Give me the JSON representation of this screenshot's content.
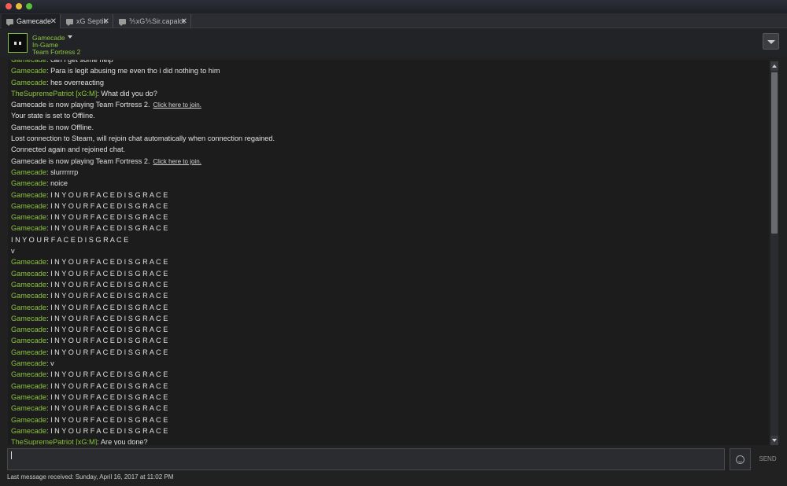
{
  "tabs": [
    {
      "label": "Gamecade"
    },
    {
      "label": "xG Septik"
    },
    {
      "label": "⅗xG⅗Sir.capalot"
    }
  ],
  "header": {
    "friend_name": "Gamecade",
    "status": "In-Game",
    "game": "Team Fortress 2"
  },
  "messages": [
    {
      "sender": "Gamecade",
      "text": "can i get some help"
    },
    {
      "sender": "Gamecade",
      "text": "Para is legit abusing me even tho i did nothing to him"
    },
    {
      "sender": "Gamecade",
      "text": "hes overreacting"
    },
    {
      "sender": "TheSupremePatriot [xG:M]",
      "text": "What did you do?"
    },
    {
      "text": "Gamecade is now playing Team Fortress 2.",
      "link": "Click here to join."
    },
    {
      "text": "Your state is set to Offline."
    },
    {
      "text": "Gamecade is now Offline."
    },
    {
      "text": "Lost connection to Steam, will rejoin chat automatically when connection regained."
    },
    {
      "text": "Connected again and rejoined chat."
    },
    {
      "text": "Gamecade is now playing Team Fortress 2.",
      "link": "Click here to join."
    },
    {
      "sender": "Gamecade",
      "text": "slurrrrrrp"
    },
    {
      "sender": "Gamecade",
      "text": "noice"
    },
    {
      "sender": "Gamecade",
      "text": "I N Y O U R F A C E D I S G R A C E"
    },
    {
      "sender": "Gamecade",
      "text": "I N Y O U R F A C E D I S G R A C E"
    },
    {
      "sender": "Gamecade",
      "text": "I N Y O U R F A C E D I S G R A C E"
    },
    {
      "sender": "Gamecade",
      "text": "I N Y O U R F A C E D I S G R A C E"
    },
    {
      "text": "I N Y O U R F A C E D I S G R A C E"
    },
    {
      "text": "v"
    },
    {
      "sender": "Gamecade",
      "text": "I N Y O U R F A C E D I S G R A C E"
    },
    {
      "sender": "Gamecade",
      "text": "I N Y O U R F A C E D I S G R A C E"
    },
    {
      "sender": "Gamecade",
      "text": "I N Y O U R F A C E D I S G R A C E"
    },
    {
      "sender": "Gamecade",
      "text": "I N Y O U R F A C E D I S G R A C E"
    },
    {
      "sender": "Gamecade",
      "text": "I N Y O U R F A C E D I S G R A C E"
    },
    {
      "sender": "Gamecade",
      "text": "I N Y O U R F A C E D I S G R A C E"
    },
    {
      "sender": "Gamecade",
      "text": "I N Y O U R F A C E D I S G R A C E"
    },
    {
      "sender": "Gamecade",
      "text": "I N Y O U R F A C E D I S G R A C E"
    },
    {
      "sender": "Gamecade",
      "text": "I N Y O U R F A C E D I S G R A C E"
    },
    {
      "sender": "Gamecade",
      "text": "v"
    },
    {
      "sender": "Gamecade",
      "text": "I N Y O U R F A C E D I S G R A C E"
    },
    {
      "sender": "Gamecade",
      "text": "I N Y O U R F A C E D I S G R A C E"
    },
    {
      "sender": "Gamecade",
      "text": "I N Y O U R F A C E D I S G R A C E"
    },
    {
      "sender": "Gamecade",
      "text": "I N Y O U R F A C E D I S G R A C E"
    },
    {
      "sender": "Gamecade",
      "text": "I N Y O U R F A C E D I S G R A C E"
    },
    {
      "sender": "Gamecade",
      "text": "I N Y O U R F A C E D I S G R A C E"
    },
    {
      "sender": "TheSupremePatriot [xG:M]",
      "text": "Are you done?"
    }
  ],
  "input": {
    "value": "",
    "send_label": "SEND"
  },
  "footer": {
    "last_message": "Last message received: Sunday, April 16, 2017 at 11:02 PM"
  },
  "colors": {
    "friend_green": "#8bc53f",
    "background": "#1c1c1d",
    "text": "#e0e0e0"
  },
  "icons": [
    "chat-icon",
    "close-icon",
    "dropdown-arrow-icon",
    "emoticon-icon",
    "scroll-up-icon",
    "scroll-down-icon"
  ]
}
